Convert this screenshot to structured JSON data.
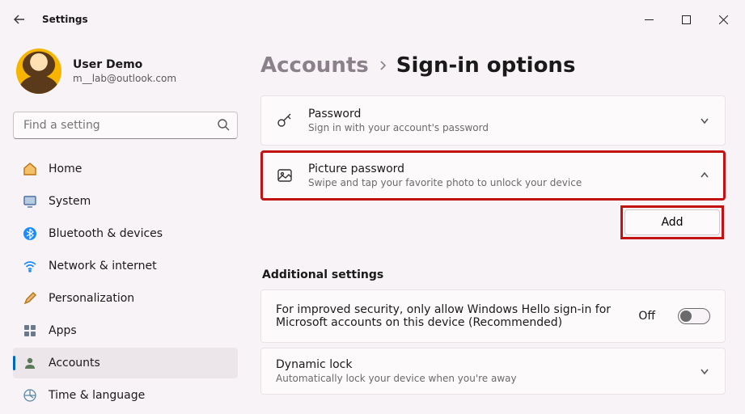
{
  "window": {
    "title": "Settings"
  },
  "profile": {
    "name": "User Demo",
    "email": "m__lab@outlook.com"
  },
  "search": {
    "placeholder": "Find a setting"
  },
  "nav": [
    {
      "label": "Home"
    },
    {
      "label": "System"
    },
    {
      "label": "Bluetooth & devices"
    },
    {
      "label": "Network & internet"
    },
    {
      "label": "Personalization"
    },
    {
      "label": "Apps"
    },
    {
      "label": "Accounts"
    },
    {
      "label": "Time & language"
    }
  ],
  "breadcrumb": {
    "parent": "Accounts",
    "current": "Sign-in options"
  },
  "cards": {
    "password": {
      "title": "Password",
      "sub": "Sign in with your account's password"
    },
    "picture": {
      "title": "Picture password",
      "sub": "Swipe and tap your favorite photo to unlock your device"
    }
  },
  "addButton": "Add",
  "additional": {
    "heading": "Additional settings",
    "hello": {
      "text": "For improved security, only allow Windows Hello sign-in for Microsoft accounts on this device (Recommended)",
      "state": "Off"
    },
    "dynamic": {
      "title": "Dynamic lock",
      "sub": "Automatically lock your device when you're away"
    }
  }
}
